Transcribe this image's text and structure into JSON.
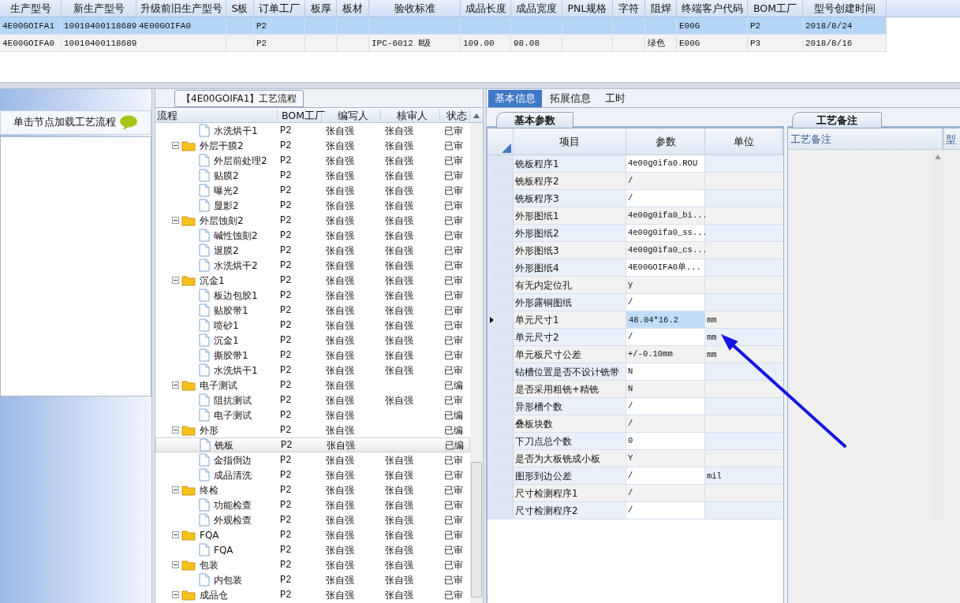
{
  "top_table": {
    "columns": [
      "生产型号",
      "新生产型号",
      "升级前旧生产型号",
      "S板",
      "订单工厂",
      "板厚",
      "板材",
      "验收标准",
      "成品长度",
      "成品宽度",
      "PNL规格",
      "字符",
      "阻焊",
      "终端客户代码",
      "BOM工厂",
      "型号创建时间"
    ],
    "rows": [
      {
        "selected": true,
        "cells": [
          "4E00GOIFA1",
          "10010400118689",
          "4E00GOIFA0",
          null,
          "P2",
          null,
          null,
          null,
          null,
          null,
          null,
          null,
          null,
          "E00G",
          "P2",
          "2018/8/24"
        ]
      },
      {
        "selected": false,
        "cells": [
          "4E00GOIFA0",
          "10010400118689",
          null,
          null,
          "P2",
          null,
          null,
          "IPC-6012 Ⅱ级",
          "109.00",
          "98.08",
          null,
          null,
          "绿色",
          "E00G",
          "P3",
          "2018/8/16"
        ]
      }
    ]
  },
  "left_panel": {
    "title": "单击节点加载工艺流程"
  },
  "flow_panel": {
    "title": "【4E00GOIFA1】工艺流程",
    "columns": [
      "流程",
      "BOM工厂",
      "编写人",
      "核审人",
      "状态"
    ],
    "nodes": [
      {
        "kind": "file",
        "label": "水洗烘干1",
        "factory": "P2",
        "writer": "张自强",
        "reviewer": "张自强",
        "status": "已审",
        "selected": false
      },
      {
        "kind": "folder",
        "label": "外层干膜2",
        "factory": "P2",
        "writer": "张自强",
        "reviewer": "张自强",
        "status": "已审",
        "selected": false,
        "children": [
          {
            "kind": "file",
            "label": "外层前处理2",
            "factory": "P2",
            "writer": "张自强",
            "reviewer": "张自强",
            "status": "已审",
            "selected": false
          },
          {
            "kind": "file",
            "label": "贴膜2",
            "factory": "P2",
            "writer": "张自强",
            "reviewer": "张自强",
            "status": "已审",
            "selected": false
          },
          {
            "kind": "file",
            "label": "曝光2",
            "factory": "P2",
            "writer": "张自强",
            "reviewer": "张自强",
            "status": "已审",
            "selected": false
          },
          {
            "kind": "file",
            "label": "显影2",
            "factory": "P2",
            "writer": "张自强",
            "reviewer": "张自强",
            "status": "已审",
            "selected": false
          }
        ]
      },
      {
        "kind": "folder",
        "label": "外层蚀刻2",
        "factory": "P2",
        "writer": "张自强",
        "reviewer": "张自强",
        "status": "已审",
        "selected": false,
        "children": [
          {
            "kind": "file",
            "label": "碱性蚀刻2",
            "factory": "P2",
            "writer": "张自强",
            "reviewer": "张自强",
            "status": "已审",
            "selected": false
          },
          {
            "kind": "file",
            "label": "退膜2",
            "factory": "P2",
            "writer": "张自强",
            "reviewer": "张自强",
            "status": "已审",
            "selected": false
          },
          {
            "kind": "file",
            "label": "水洗烘干2",
            "factory": "P2",
            "writer": "张自强",
            "reviewer": "张自强",
            "status": "已审",
            "selected": false
          }
        ]
      },
      {
        "kind": "folder",
        "label": "沉金1",
        "factory": "P2",
        "writer": "张自强",
        "reviewer": "张自强",
        "status": "已审",
        "selected": false,
        "children": [
          {
            "kind": "file",
            "label": "板边包胶1",
            "factory": "P2",
            "writer": "张自强",
            "reviewer": "张自强",
            "status": "已审",
            "selected": false
          },
          {
            "kind": "file",
            "label": "贴胶带1",
            "factory": "P2",
            "writer": "张自强",
            "reviewer": "张自强",
            "status": "已审",
            "selected": false
          },
          {
            "kind": "file",
            "label": "喷砂1",
            "factory": "P2",
            "writer": "张自强",
            "reviewer": "张自强",
            "status": "已审",
            "selected": false
          },
          {
            "kind": "file",
            "label": "沉金1",
            "factory": "P2",
            "writer": "张自强",
            "reviewer": "张自强",
            "status": "已审",
            "selected": false
          },
          {
            "kind": "file",
            "label": "撕胶带1",
            "factory": "P2",
            "writer": "张自强",
            "reviewer": "张自强",
            "status": "已审",
            "selected": false
          },
          {
            "kind": "file",
            "label": "水洗烘干1",
            "factory": "P2",
            "writer": "张自强",
            "reviewer": "张自强",
            "status": "已审",
            "selected": false
          }
        ]
      },
      {
        "kind": "folder",
        "label": "电子测试",
        "factory": "P2",
        "writer": "张自强",
        "status": "已编",
        "selected": false,
        "children": [
          {
            "kind": "file",
            "label": "阻抗测试",
            "factory": "P2",
            "writer": "张自强",
            "reviewer": "张自强",
            "status": "已审",
            "selected": false
          },
          {
            "kind": "file",
            "label": "电子测试",
            "factory": "P2",
            "writer": "张自强",
            "status": "已编",
            "selected": false
          }
        ]
      },
      {
        "kind": "folder",
        "label": "外形",
        "factory": "P2",
        "writer": "张自强",
        "status": "已编",
        "selected": false,
        "children": [
          {
            "kind": "file",
            "label": "铣板",
            "factory": "P2",
            "writer": "张自强",
            "status": "已编",
            "selected": true
          },
          {
            "kind": "file",
            "label": "金指倒边",
            "factory": "P2",
            "writer": "张自强",
            "reviewer": "张自强",
            "status": "已审",
            "selected": false
          },
          {
            "kind": "file",
            "label": "成品清洗",
            "factory": "P2",
            "writer": "张自强",
            "reviewer": "张自强",
            "status": "已审",
            "selected": false
          }
        ]
      },
      {
        "kind": "folder",
        "label": "终检",
        "factory": "P2",
        "writer": "张自强",
        "reviewer": "张自强",
        "status": "已审",
        "selected": false,
        "children": [
          {
            "kind": "file",
            "label": "功能检查",
            "factory": "P2",
            "writer": "张自强",
            "reviewer": "张自强",
            "status": "已审",
            "selected": false
          },
          {
            "kind": "file",
            "label": "外观检查",
            "factory": "P2",
            "writer": "张自强",
            "reviewer": "张自强",
            "status": "已审",
            "selected": false
          }
        ]
      },
      {
        "kind": "folder",
        "label": "FQA",
        "factory": "P2",
        "writer": "张自强",
        "reviewer": "张自强",
        "status": "已审",
        "selected": false,
        "children": [
          {
            "kind": "file",
            "label": "FQA",
            "factory": "P2",
            "writer": "张自强",
            "reviewer": "张自强",
            "status": "已审",
            "selected": false
          }
        ]
      },
      {
        "kind": "folder",
        "label": "包装",
        "factory": "P2",
        "writer": "张自强",
        "reviewer": "张自强",
        "status": "已审",
        "selected": false,
        "children": [
          {
            "kind": "file",
            "label": "内包装",
            "factory": "P2",
            "writer": "张自强",
            "reviewer": "张自强",
            "status": "已审",
            "selected": false
          }
        ]
      },
      {
        "kind": "folder",
        "label": "成品仓",
        "factory": "P2",
        "writer": "张自强",
        "reviewer": "张自强",
        "status": "已审",
        "selected": false
      }
    ]
  },
  "detail_panel": {
    "tabs": [
      {
        "label": "基本信息",
        "selected": true
      },
      {
        "label": "拓展信息",
        "selected": false
      },
      {
        "label": "工时",
        "selected": false
      }
    ],
    "param_tab": "基本参数",
    "param_columns": [
      "项目",
      "参数",
      "单位"
    ],
    "params": [
      {
        "item": "铣板程序1",
        "value": "4e00g0ifa0.ROU",
        "current": false
      },
      {
        "item": "铣板程序2",
        "value": "/",
        "current": false
      },
      {
        "item": "铣板程序3",
        "value": "/",
        "current": false
      },
      {
        "item": "外形图纸1",
        "value": "4e00g0ifa0_bi...",
        "current": false
      },
      {
        "item": "外形图纸2",
        "value": "4e00g0ifa0_ss...",
        "current": false
      },
      {
        "item": "外形图纸3",
        "value": "4e00g0ifa0_cs...",
        "current": false
      },
      {
        "item": "外形图纸4",
        "value": "4E00GOIFA0单...",
        "current": false
      },
      {
        "item": "有无内定位孔",
        "value": "y",
        "current": false
      },
      {
        "item": "外形露铜图纸",
        "value": "/",
        "current": false
      },
      {
        "item": "单元尺寸1",
        "value": "48.04*16.2",
        "unit": "mm",
        "current": true
      },
      {
        "item": "单元尺寸2",
        "value": "/",
        "unit": "mm",
        "current": false
      },
      {
        "item": "单元板尺寸公差",
        "value": "+/-0.10mm",
        "unit": "mm",
        "current": false
      },
      {
        "item": "钻槽位置是否不设计铣带",
        "value": "N",
        "current": false
      },
      {
        "item": "是否采用粗铣+精铣",
        "value": "N",
        "current": false
      },
      {
        "item": "异形槽个数",
        "value": "/",
        "current": false
      },
      {
        "item": "叠板块数",
        "value": "/",
        "current": false
      },
      {
        "item": "下刀点总个数",
        "value": "0",
        "current": false
      },
      {
        "item": "是否为大板铣成小板",
        "value": "Y",
        "current": false
      },
      {
        "item": "图形到边公差",
        "value": "/",
        "unit": "mil",
        "current": false
      },
      {
        "item": "尺寸检测程序1",
        "value": "/",
        "current": false
      },
      {
        "item": "尺寸检测程序2",
        "value": "/",
        "current": false
      }
    ],
    "notes_tab": "工艺备注",
    "notes_columns": [
      "工艺备注",
      "型"
    ]
  }
}
